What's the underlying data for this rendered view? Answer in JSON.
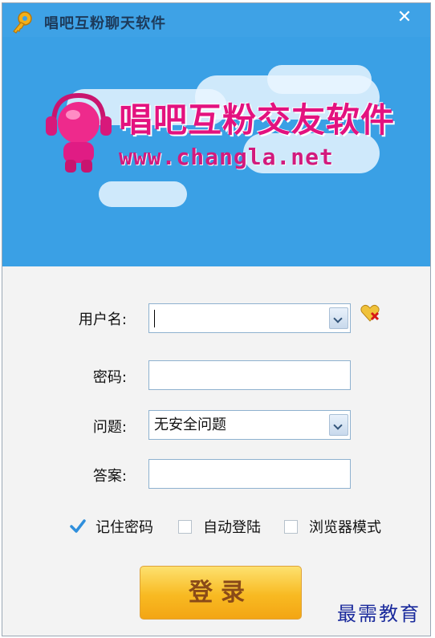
{
  "window": {
    "title": "唱吧互粉聊天软件",
    "close_label": "✕"
  },
  "banner": {
    "brand_cn": "唱吧互粉交友软件",
    "brand_url": "www.changla.net"
  },
  "form": {
    "username_label": "用户名:",
    "username_value": "",
    "password_label": "密码:",
    "password_value": "",
    "question_label": "问题:",
    "question_value": "无安全问题",
    "answer_label": "答案:",
    "answer_value": ""
  },
  "options": {
    "remember_label": "记住密码",
    "remember_checked": true,
    "autologin_label": "自动登陆",
    "autologin_checked": false,
    "browser_label": "浏览器模式",
    "browser_checked": false
  },
  "login_button_label": "登录",
  "watermark": "最需教育",
  "colors": {
    "title_bar": "#3ea2e6",
    "brand_pink": "#e3127f",
    "login_gradient_top": "#fde16f",
    "login_gradient_bottom": "#f3a514",
    "checkmark_blue": "#2f8fdc"
  }
}
